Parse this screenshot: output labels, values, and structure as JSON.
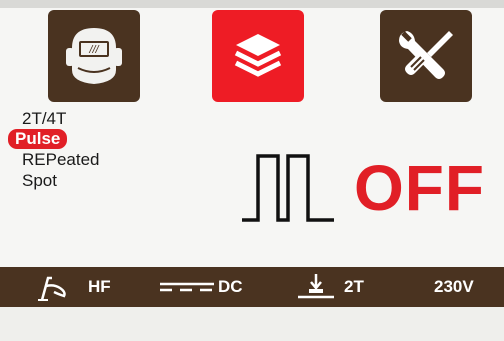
{
  "colors": {
    "brown_panel": "#4a3320",
    "accent_red": "#e11f26",
    "background": "#f6f6f4"
  },
  "top_icons": [
    {
      "name": "welding-helmet-icon",
      "state": "inactive"
    },
    {
      "name": "layers-icon",
      "state": "active"
    },
    {
      "name": "wrench-screwdriver-icon",
      "state": "inactive"
    }
  ],
  "helmet_glyph": "///",
  "menu": {
    "items": [
      {
        "label": "2T/4T",
        "selected": false
      },
      {
        "label": "Pulse",
        "selected": true
      },
      {
        "label": "REPeated",
        "selected": false
      },
      {
        "label": "Spot",
        "selected": false
      }
    ]
  },
  "status": {
    "value": "OFF"
  },
  "status_bar": {
    "torch_label": "HF",
    "current_label": "DC",
    "trigger_label": "2T",
    "voltage_label": "230V"
  }
}
